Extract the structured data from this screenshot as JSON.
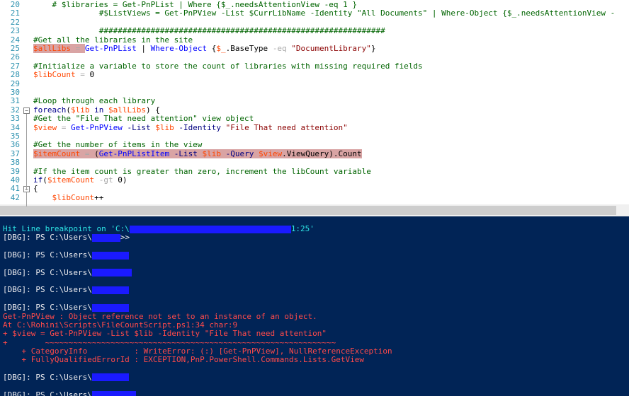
{
  "editor": {
    "line_numbers": [
      "20",
      "21",
      "22",
      "23",
      "24",
      "25",
      "26",
      "27",
      "28",
      "29",
      "30",
      "31",
      "32",
      "33",
      "34",
      "35",
      "36",
      "37",
      "38",
      "39",
      "40",
      "41",
      "42"
    ],
    "lines": [
      {
        "segments": [
          [
            "comment",
            "    # $libraries = Get-PnPList | Where {$_.needsAttentionView -eq 1 }"
          ]
        ]
      },
      {
        "segments": [
          [
            "comment",
            "              #$ListViews = Get-PnPView -List $CurrLibName -Identity \"All Documents\" | Where-Object {$_.needsAttentionView -"
          ]
        ]
      },
      {
        "segments": []
      },
      {
        "segments": [
          [
            "comment",
            "              #############################################################"
          ]
        ]
      },
      {
        "segments": [
          [
            "comment",
            "#Get all the libraries in the site"
          ]
        ]
      },
      {
        "segments": [
          [
            "var",
            "$allLibs"
          ],
          [
            "op",
            " = "
          ],
          [
            "cmd",
            "Get-PnPList"
          ],
          [
            "plain",
            " | "
          ],
          [
            "cmd",
            "Where-Object"
          ],
          [
            "plain",
            " {"
          ],
          [
            "var",
            "$_"
          ],
          [
            "plain",
            ".BaseType "
          ],
          [
            "op",
            "-eq"
          ],
          [
            "plain",
            " "
          ],
          [
            "str",
            "\"DocumentLibrary\""
          ],
          [
            "plain",
            "}"
          ]
        ]
      },
      {
        "segments": []
      },
      {
        "segments": [
          [
            "comment",
            "#Initialize a variable to store the count of libraries with missing required fields"
          ]
        ]
      },
      {
        "segments": [
          [
            "var",
            "$libCount"
          ],
          [
            "op",
            " = "
          ],
          [
            "plain",
            "0"
          ]
        ]
      },
      {
        "segments": []
      },
      {
        "segments": []
      },
      {
        "segments": [
          [
            "comment",
            "#Loop through each library"
          ]
        ]
      },
      {
        "segments": [
          [
            "kw",
            "foreach"
          ],
          [
            "plain",
            "("
          ],
          [
            "var",
            "$lib"
          ],
          [
            "plain",
            " "
          ],
          [
            "kw",
            "in"
          ],
          [
            "plain",
            " "
          ],
          [
            "var",
            "$allLibs"
          ],
          [
            "plain",
            ") {"
          ]
        ]
      },
      {
        "segments": [
          [
            "comment",
            "#Get the \"File That need attention\" view object"
          ]
        ]
      },
      {
        "segments": [
          [
            "var",
            "$view"
          ],
          [
            "op",
            " = "
          ],
          [
            "cmd",
            "Get-PnPView"
          ],
          [
            "plain",
            " "
          ],
          [
            "param",
            "-List"
          ],
          [
            "plain",
            " "
          ],
          [
            "var",
            "$lib"
          ],
          [
            "plain",
            " "
          ],
          [
            "param",
            "-Identity"
          ],
          [
            "plain",
            " "
          ],
          [
            "str",
            "\"File That need attention\""
          ]
        ]
      },
      {
        "segments": []
      },
      {
        "segments": [
          [
            "comment",
            "#Get the number of items in the view"
          ]
        ]
      },
      {
        "segments": [
          [
            "var",
            "$itemCount"
          ],
          [
            "op",
            " = "
          ],
          [
            "plain",
            "("
          ],
          [
            "cmd",
            "Get-PnPListItem"
          ],
          [
            "plain",
            " "
          ],
          [
            "param",
            "-List"
          ],
          [
            "plain",
            " "
          ],
          [
            "var",
            "$lib"
          ],
          [
            "plain",
            " "
          ],
          [
            "param",
            "-Query"
          ],
          [
            "plain",
            " "
          ],
          [
            "var",
            "$view"
          ],
          [
            "plain",
            ".ViewQuery).Count"
          ]
        ]
      },
      {
        "segments": []
      },
      {
        "segments": [
          [
            "comment",
            "#If the item count is greater than zero, increment the libCount variable"
          ]
        ]
      },
      {
        "segments": [
          [
            "kw",
            "if"
          ],
          [
            "plain",
            "("
          ],
          [
            "var",
            "$itemCount"
          ],
          [
            "plain",
            " "
          ],
          [
            "op",
            "-gt"
          ],
          [
            "plain",
            " 0)"
          ]
        ]
      },
      {
        "segments": [
          [
            "plain",
            "{"
          ]
        ]
      },
      {
        "segments": [
          [
            "plain",
            "    "
          ],
          [
            "var",
            "$libCount"
          ],
          [
            "plain",
            "++"
          ]
        ]
      }
    ]
  },
  "console": {
    "lines": [
      {
        "color": "cyan",
        "parts": [
          [
            "text",
            "Hit Line breakpoint on 'C:\\"
          ],
          [
            "redact",
            "r1"
          ],
          [
            "text",
            "1:25'"
          ]
        ]
      },
      {
        "color": "white",
        "parts": [
          [
            "text",
            "[DBG]: PS C:\\Users\\"
          ],
          [
            "redact",
            "r2"
          ],
          [
            "text",
            ">>"
          ]
        ]
      },
      {
        "color": "white",
        "parts": []
      },
      {
        "color": "white",
        "parts": [
          [
            "text",
            "[DBG]: PS C:\\Users\\"
          ],
          [
            "redact",
            "r3"
          ]
        ]
      },
      {
        "color": "white",
        "parts": []
      },
      {
        "color": "white",
        "parts": [
          [
            "text",
            "[DBG]: PS C:\\Users\\"
          ],
          [
            "redact",
            "r4"
          ]
        ]
      },
      {
        "color": "white",
        "parts": []
      },
      {
        "color": "white",
        "parts": [
          [
            "text",
            "[DBG]: PS C:\\Users\\"
          ],
          [
            "redact",
            "r5"
          ]
        ]
      },
      {
        "color": "white",
        "parts": []
      },
      {
        "color": "white",
        "parts": [
          [
            "text",
            "[DBG]: PS C:\\Users\\"
          ],
          [
            "redact",
            "r6"
          ]
        ]
      },
      {
        "color": "red",
        "parts": [
          [
            "text",
            "Get-PnPView : Object reference not set to an instance of an object."
          ]
        ]
      },
      {
        "color": "red",
        "parts": [
          [
            "text",
            "At C:\\Rohini\\Scripts\\FileCountScript.ps1:34 char:9"
          ]
        ]
      },
      {
        "color": "red",
        "parts": [
          [
            "text",
            "+ $view = Get-PnPView -List $lib -Identity \"File That need attention\""
          ]
        ]
      },
      {
        "color": "red",
        "parts": [
          [
            "text",
            "+        ~~~~~~~~~~~~~~~~~~~~~~~~~~~~~~~~~~~~~~~~~~~~~~~~~~~~~~~~~~~~~~"
          ]
        ]
      },
      {
        "color": "red",
        "parts": [
          [
            "text",
            "    + CategoryInfo          : WriteError: (:) [Get-PnPView], NullReferenceException"
          ]
        ]
      },
      {
        "color": "red",
        "parts": [
          [
            "text",
            "    + FullyQualifiedErrorId : EXCEPTION,PnP.PowerShell.Commands.Lists.GetView"
          ]
        ]
      },
      {
        "color": "white",
        "parts": []
      },
      {
        "color": "white",
        "parts": [
          [
            "text",
            "[DBG]: PS C:\\Users\\"
          ],
          [
            "redact",
            "r7"
          ]
        ]
      },
      {
        "color": "white",
        "parts": []
      },
      {
        "color": "white",
        "parts": [
          [
            "text",
            "[DBG]: PS C:\\Users\\"
          ],
          [
            "redact",
            "r8"
          ]
        ]
      }
    ]
  },
  "colors": {
    "console_bg": "#012456",
    "editor_bg": "#ffffff",
    "breakpoint_highlight": "#d9a4a4",
    "selection": "#3399ff",
    "redaction": "#1a1aff"
  }
}
